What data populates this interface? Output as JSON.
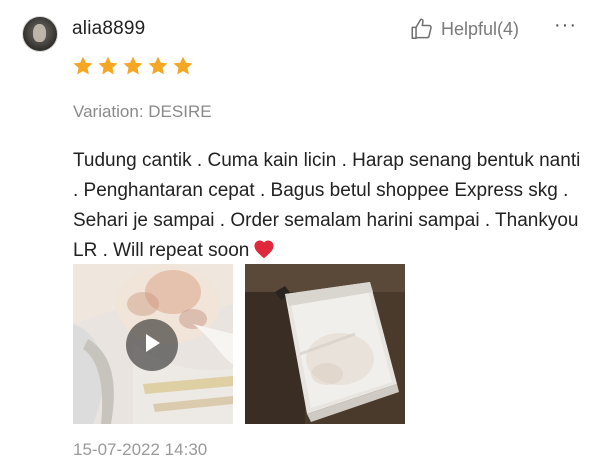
{
  "review": {
    "username": "alia8899",
    "helpful_label": "Helpful(4)",
    "more_label": "···",
    "rating": 5,
    "star_color": "#f5a623",
    "variation": "Variation: DESIRE",
    "comment": "Tudung cantik . Cuma kain licin . Harap senang bentuk nanti . Penghantaran cepat . Bagus betul shoppee Express skg . Sehari je sampai . Order semalam harini sampai . Thankyou LR . Will repeat soon",
    "comment_emoji": "red-heart-icon",
    "timestamp": "15-07-2022 14:30"
  },
  "media": [
    {
      "kind": "video",
      "overlay_icon": "play-icon"
    },
    {
      "kind": "photo"
    }
  ],
  "icons": {
    "helpful": "thumbs-up-icon",
    "more": "more-dots-icon"
  }
}
